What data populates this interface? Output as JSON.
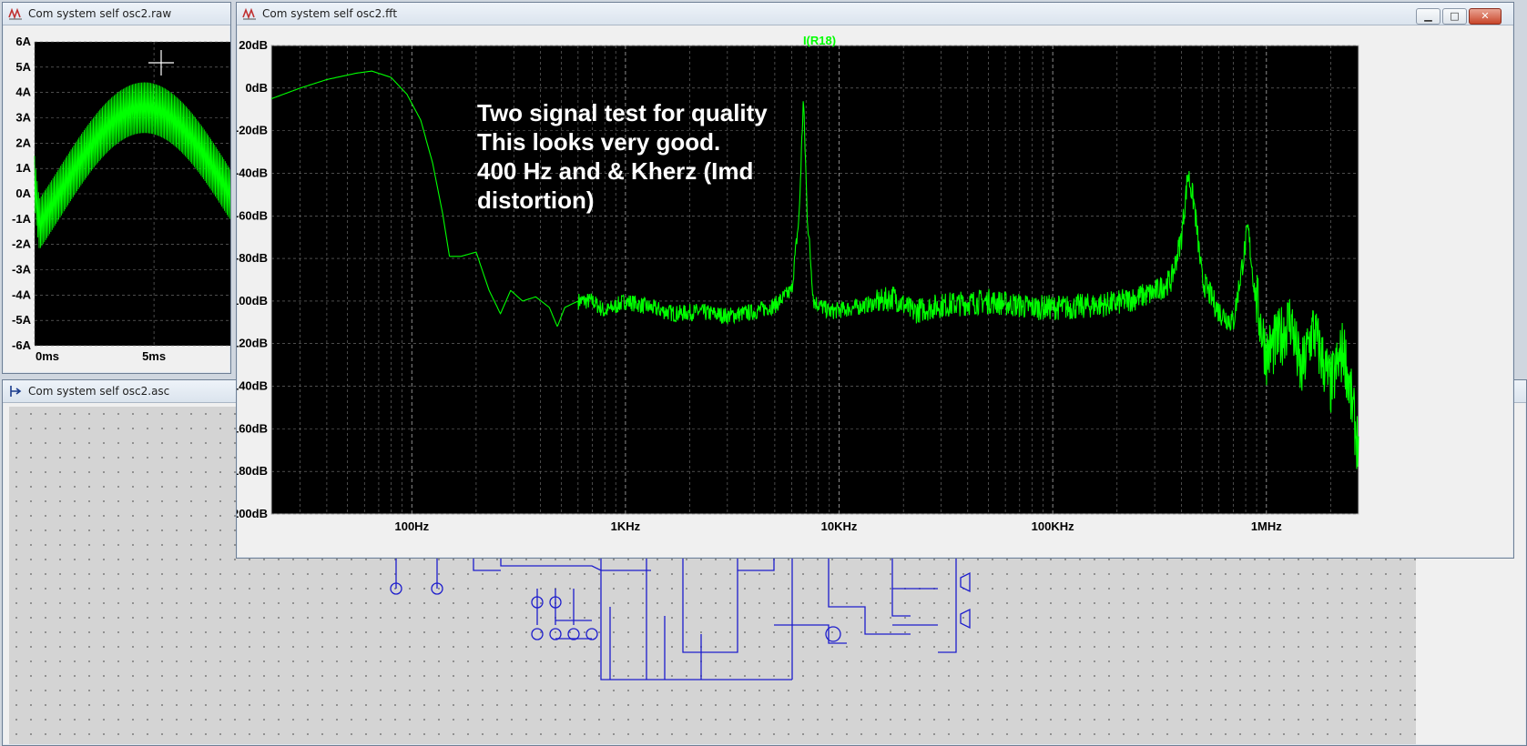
{
  "windows": {
    "raw": {
      "title": "Com system self osc2.raw"
    },
    "asc": {
      "title": "Com system self osc2.asc"
    },
    "fft": {
      "title": "Com system self osc2.fft",
      "trace_label": "I(R18)",
      "controls": {
        "minimize": "▁",
        "maximize": "□",
        "close": "✕"
      }
    }
  },
  "annotation": {
    "lines": [
      "Two signal test for quality",
      "This looks very good.",
      "400 Hz and & Kherz (Imd",
      "distortion)"
    ]
  },
  "colors": {
    "trace": "#00ff00",
    "plot_bg": "#000000",
    "grid": "#7a7a7a",
    "schematic_wire": "#0000cc"
  },
  "chart_data": [
    {
      "type": "line",
      "title": "",
      "series": [
        {
          "name": "I(R18)"
        }
      ],
      "x_scale": "log",
      "x_ticks": [
        "100Hz",
        "1KHz",
        "10KHz",
        "100KHz",
        "1MHz"
      ],
      "x_tick_values": [
        100,
        1000,
        10000,
        100000,
        1000000
      ],
      "xlim": [
        22,
        2700000
      ],
      "y_ticks": [
        "20dB",
        "0dB",
        "-20dB",
        "-40dB",
        "-60dB",
        "-80dB",
        "-100dB",
        "-120dB",
        "-140dB",
        "-160dB",
        "-180dB",
        "-200dB"
      ],
      "ylim": [
        -200,
        20
      ],
      "grid": true,
      "points": [
        [
          22,
          -5
        ],
        [
          30,
          0
        ],
        [
          40,
          4
        ],
        [
          55,
          7
        ],
        [
          65,
          8
        ],
        [
          80,
          5
        ],
        [
          95,
          -3
        ],
        [
          110,
          -15
        ],
        [
          125,
          -35
        ],
        [
          140,
          -60
        ],
        [
          150,
          -79
        ],
        [
          170,
          -79
        ],
        [
          200,
          -77
        ],
        [
          230,
          -95
        ],
        [
          260,
          -106
        ],
        [
          290,
          -95
        ],
        [
          330,
          -100
        ],
        [
          380,
          -98
        ],
        [
          440,
          -103
        ],
        [
          480,
          -112
        ],
        [
          520,
          -103
        ],
        [
          600,
          -100
        ],
        [
          700,
          -100
        ],
        [
          800,
          -105
        ],
        [
          1000,
          -100
        ],
        [
          1300,
          -103
        ],
        [
          1700,
          -106
        ],
        [
          2200,
          -105
        ],
        [
          3000,
          -107
        ],
        [
          4000,
          -105
        ],
        [
          5000,
          -102
        ],
        [
          6000,
          -95
        ],
        [
          6500,
          -60
        ],
        [
          6800,
          -5
        ],
        [
          7100,
          -60
        ],
        [
          7600,
          -100
        ],
        [
          9000,
          -105
        ],
        [
          12000,
          -103
        ],
        [
          16000,
          -100
        ],
        [
          18000,
          -98
        ],
        [
          22000,
          -105
        ],
        [
          30000,
          -102
        ],
        [
          50000,
          -100
        ],
        [
          80000,
          -103
        ],
        [
          120000,
          -103
        ],
        [
          200000,
          -101
        ],
        [
          300000,
          -96
        ],
        [
          360000,
          -90
        ],
        [
          400000,
          -70
        ],
        [
          430000,
          -40
        ],
        [
          460000,
          -55
        ],
        [
          500000,
          -90
        ],
        [
          600000,
          -105
        ],
        [
          700000,
          -110
        ],
        [
          780000,
          -80
        ],
        [
          820000,
          -66
        ],
        [
          880000,
          -95
        ],
        [
          1000000,
          -125
        ],
        [
          1150000,
          -118
        ],
        [
          1300000,
          -108
        ],
        [
          1450000,
          -135
        ],
        [
          1650000,
          -113
        ],
        [
          2000000,
          -140
        ],
        [
          2300000,
          -122
        ],
        [
          2700000,
          -170
        ]
      ]
    },
    {
      "type": "line",
      "title": "",
      "x_ticks": [
        "0ms",
        "5ms"
      ],
      "x_tick_values": [
        0,
        5
      ],
      "xlim": [
        0,
        8.2
      ],
      "y_ticks": [
        "6A",
        "5A",
        "4A",
        "3A",
        "2A",
        "1A",
        "0A",
        "-1A",
        "-2A",
        "-3A",
        "-4A",
        "-5A",
        "-6A"
      ],
      "ylim": [
        -6,
        6
      ],
      "grid": true,
      "envelope": {
        "peak": 4.4,
        "peak_ms": 4.6,
        "band_width": 2.0,
        "start_mid": 0.5
      }
    }
  ]
}
